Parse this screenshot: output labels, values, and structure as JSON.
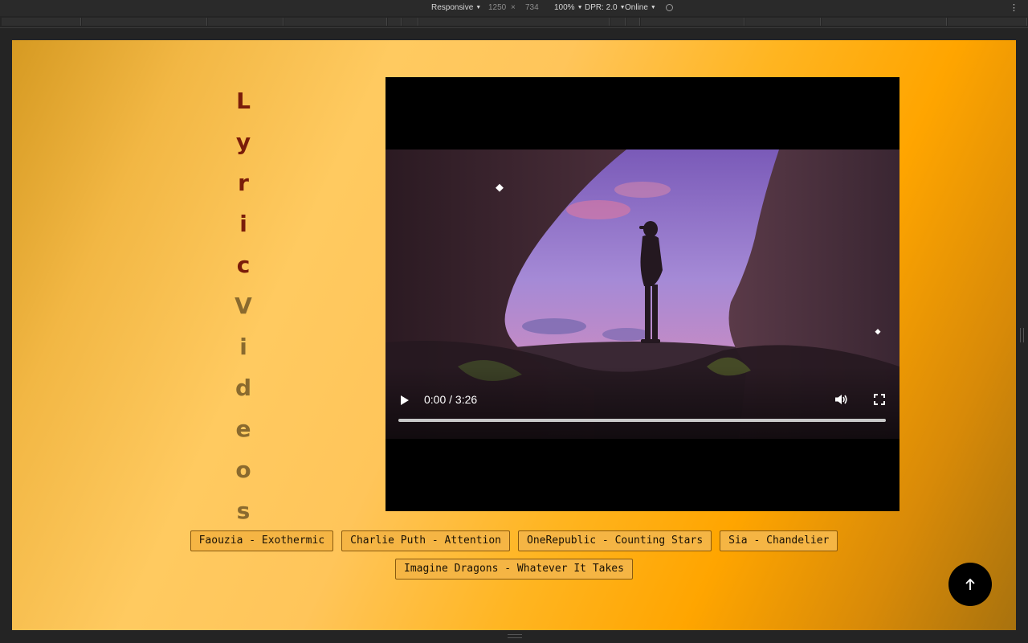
{
  "devtools": {
    "device": "Responsive",
    "width": "1250",
    "times": "×",
    "height": "734",
    "zoom": "100%",
    "dpr": "DPR: 2.0",
    "network": "Online",
    "icons": {
      "more": "more-vert-icon",
      "rotate": "rotate-icon",
      "caret": "caret-down-icon"
    }
  },
  "page": {
    "title_letters": [
      "L",
      "y",
      "r",
      "i",
      "c",
      "V",
      "i",
      "d",
      "e",
      "o",
      "s"
    ],
    "colors": {
      "title_primary": "#7a1c0a",
      "title_secondary": "#8a6a2e",
      "gradient_light": "#ffca60",
      "gradient_orange": "#ffa500",
      "button_bg": "#f5b544",
      "top_button": "#000000"
    },
    "video": {
      "current_time": "0:00",
      "separator": "/",
      "duration": "3:26",
      "progress_fraction": 0,
      "icons": {
        "play": "play-icon",
        "volume": "volume-icon",
        "fullscreen": "fullscreen-icon"
      }
    },
    "songs": [
      "Faouzia - Exothermic",
      "Charlie Puth - Attention",
      "OneRepublic - Counting Stars",
      "Sia - Chandelier",
      "Imagine Dragons - Whatever It Takes"
    ],
    "scroll_top_icon": "arrow-up-icon"
  }
}
